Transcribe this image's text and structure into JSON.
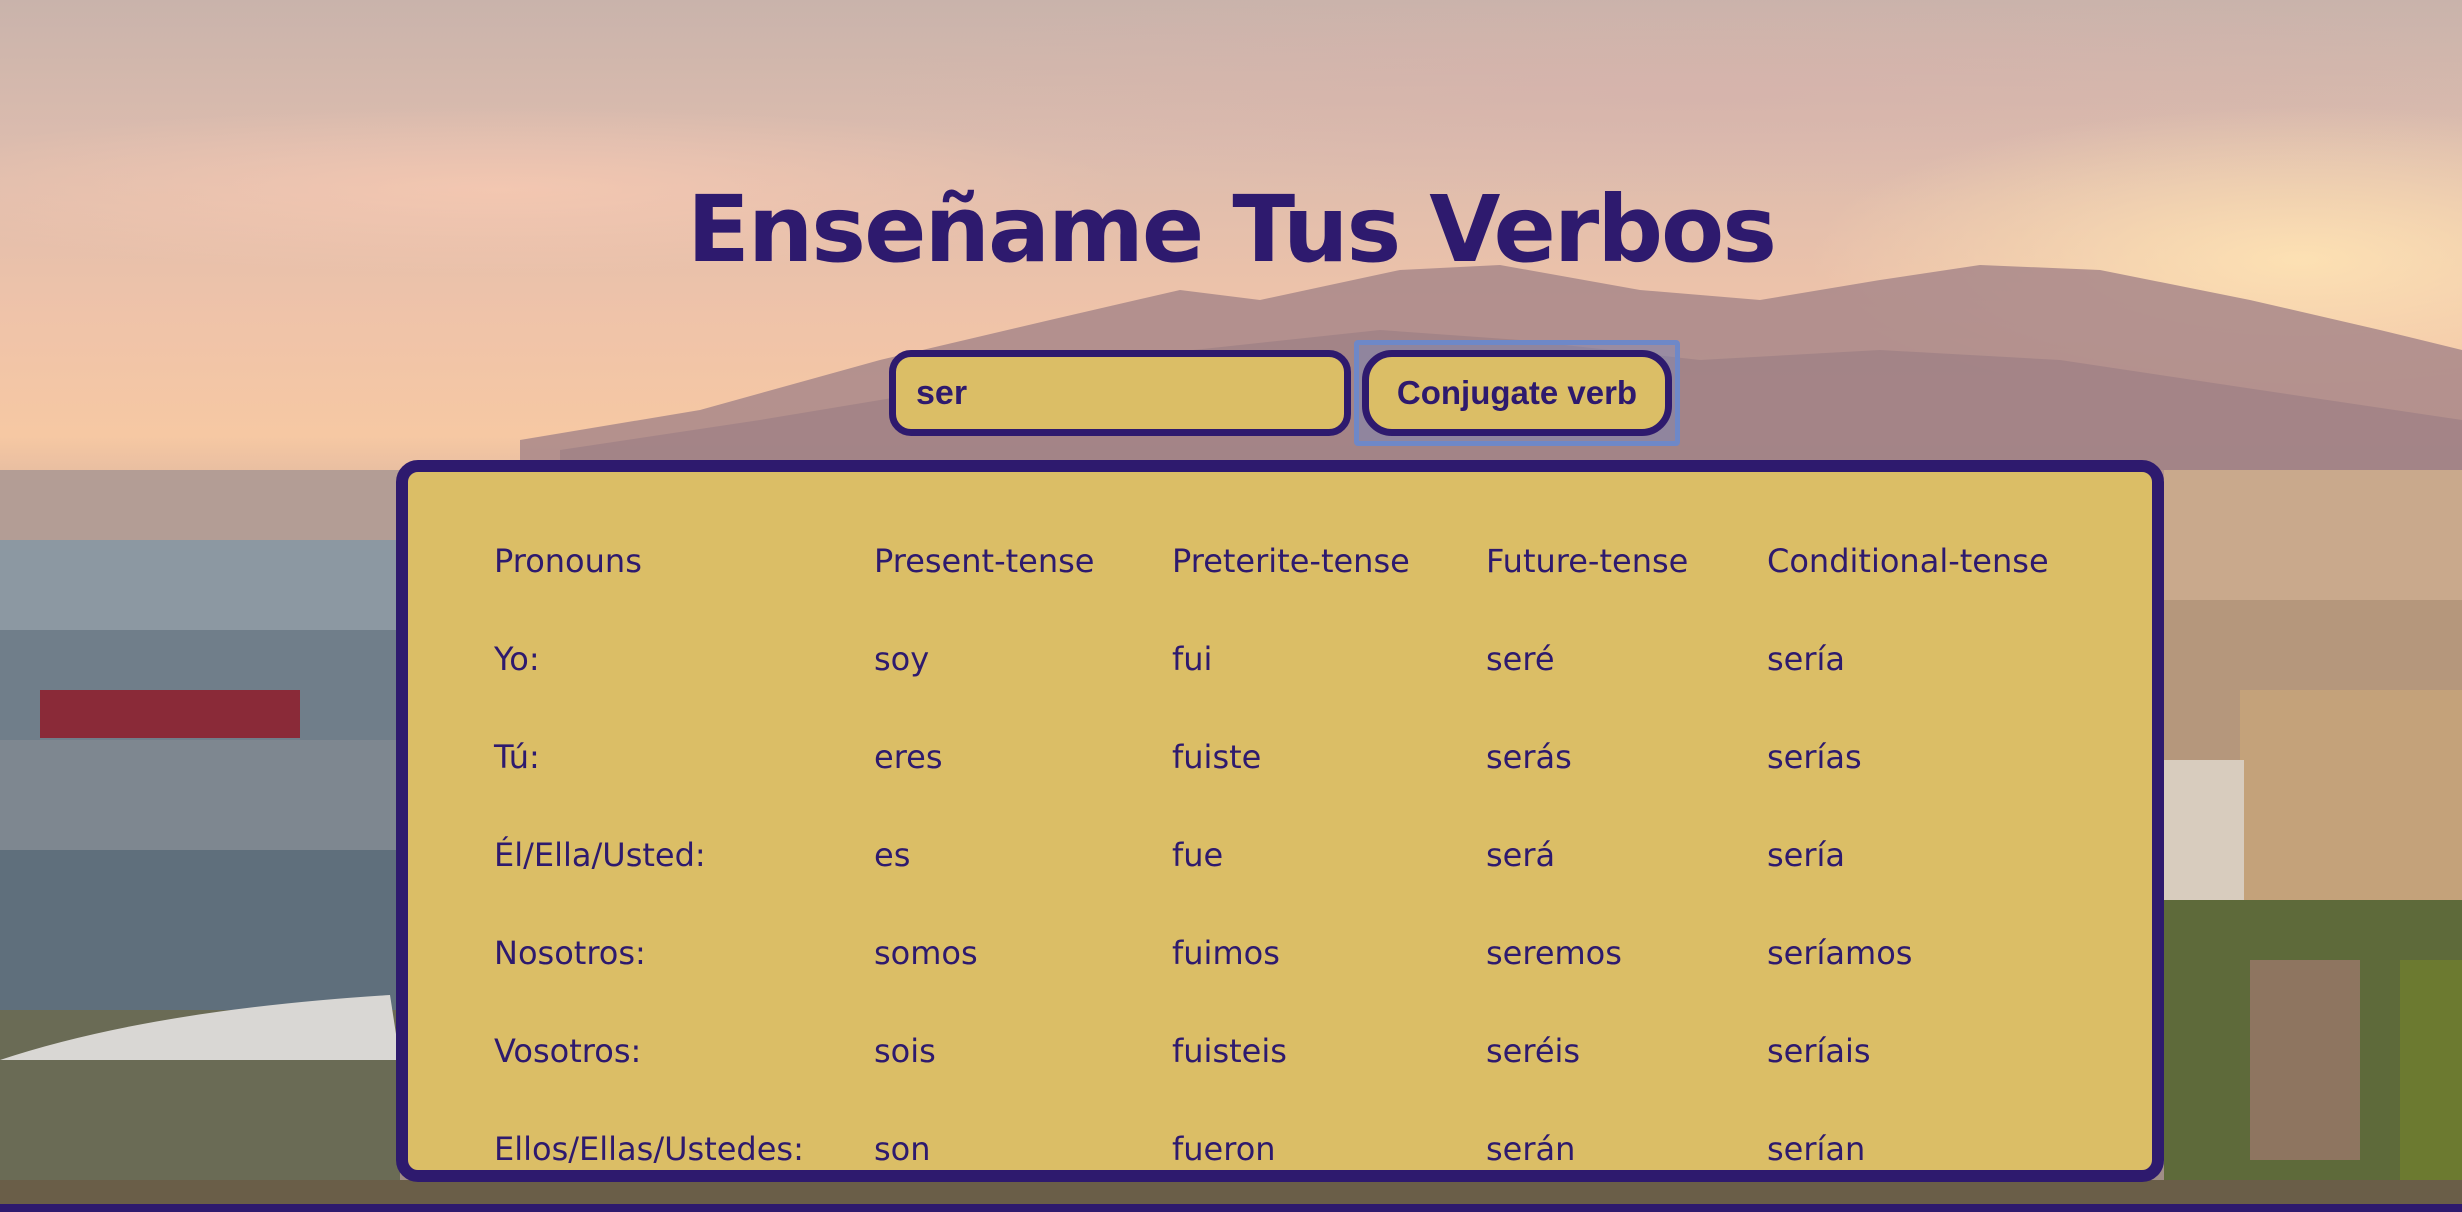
{
  "title": "Enseñame Tus Verbos",
  "search": {
    "value": "ser",
    "button_label": "Conjugate verb"
  },
  "table": {
    "headers": [
      "Pronouns",
      "Present-tense",
      "Preterite-tense",
      "Future-tense",
      "Conditional-tense"
    ],
    "rows": [
      [
        "Yo:",
        "soy",
        "fui",
        "seré",
        "sería"
      ],
      [
        "Tú:",
        "eres",
        "fuiste",
        "serás",
        "serías"
      ],
      [
        "Él/Ella/Usted:",
        "es",
        "fue",
        "será",
        "sería"
      ],
      [
        "Nosotros:",
        "somos",
        "fuimos",
        "seremos",
        "seríamos"
      ],
      [
        "Vosotros:",
        "sois",
        "fuisteis",
        "seréis",
        "seríais"
      ],
      [
        "Ellos/Ellas/Ustedes:",
        "son",
        "fueron",
        "serán",
        "serían"
      ]
    ]
  },
  "colors": {
    "accent": "#2e1a6e",
    "panel": "#dbbe66",
    "focus_ring": "#6e88c8"
  }
}
